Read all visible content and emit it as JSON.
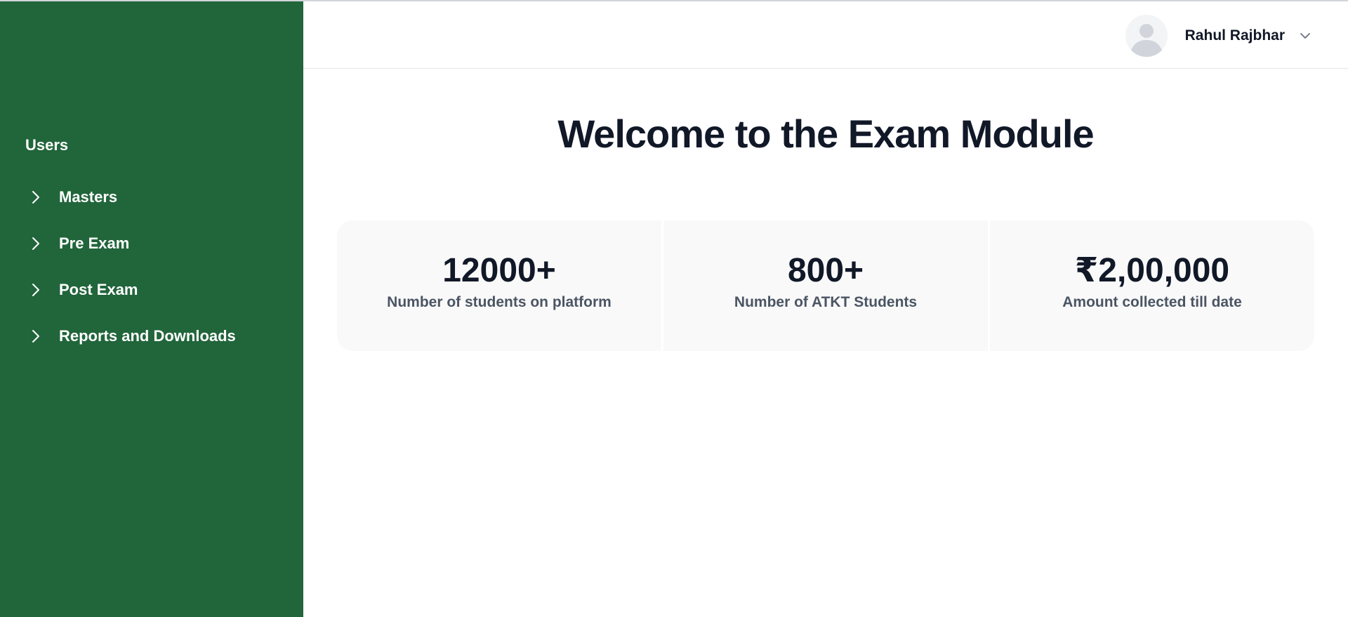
{
  "sidebar": {
    "heading": "Users",
    "items": [
      {
        "label": "Masters",
        "icon": "chevron-right-icon"
      },
      {
        "label": "Pre Exam",
        "icon": "chevron-right-icon"
      },
      {
        "label": "Post Exam",
        "icon": "chevron-right-icon"
      },
      {
        "label": "Reports and Downloads",
        "icon": "chevron-right-icon"
      }
    ]
  },
  "header": {
    "user": {
      "name": "Rahul Rajbhar",
      "avatar_icon": "user-avatar-icon",
      "dropdown_icon": "chevron-down-icon"
    }
  },
  "main": {
    "title": "Welcome to the Exam Module",
    "stats": [
      {
        "value": "12000+",
        "label": "Number of students on platform"
      },
      {
        "value": "800+",
        "label": "Number of ATKT Students"
      },
      {
        "value": "₹2,00,000",
        "label": "Amount collected till date"
      }
    ]
  },
  "colors": {
    "sidebar_bg": "#21653b",
    "card_bg": "#f9f9f9",
    "text_primary": "#111827",
    "text_secondary": "#4b5563"
  }
}
